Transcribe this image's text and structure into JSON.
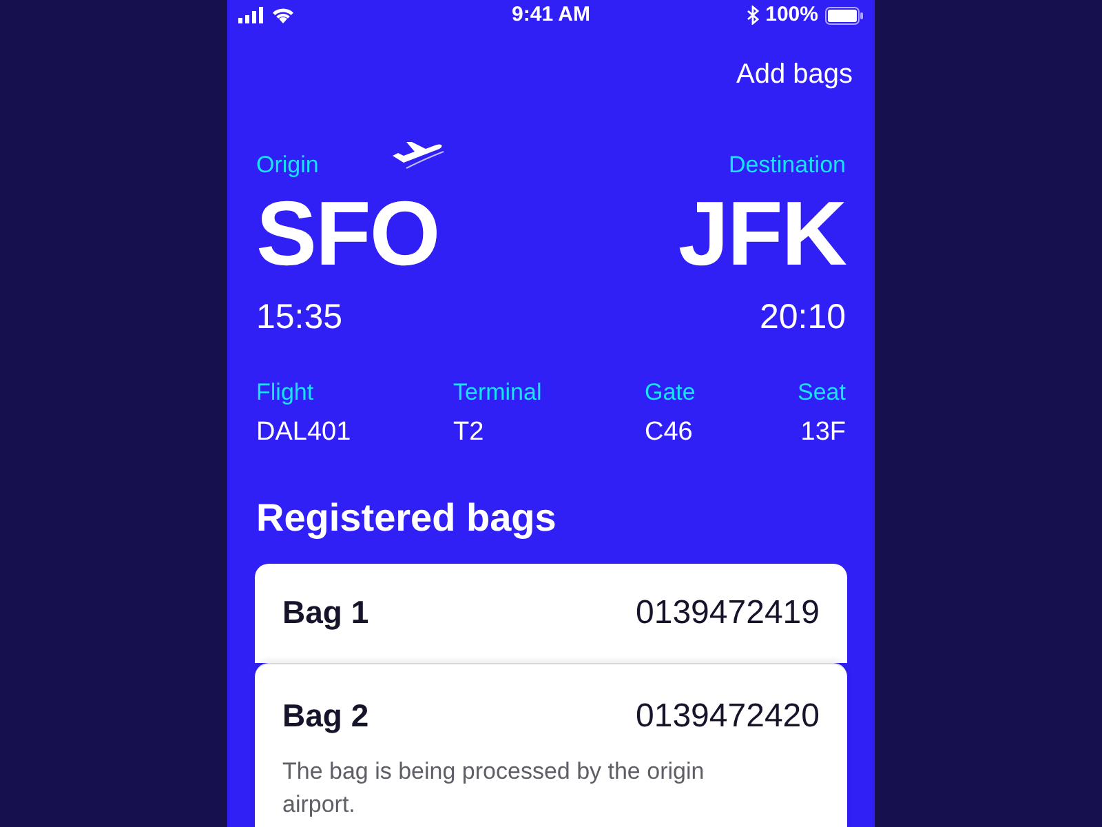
{
  "status_bar": {
    "time": "9:41 AM",
    "battery": "100%"
  },
  "header": {
    "action": "Add bags"
  },
  "route": {
    "origin": {
      "label": "Origin",
      "code": "SFO",
      "time": "15:35"
    },
    "destination": {
      "label": "Destination",
      "code": "JFK",
      "time": "20:10"
    }
  },
  "details": [
    {
      "label": "Flight",
      "value": "DAL401"
    },
    {
      "label": "Terminal",
      "value": "T2"
    },
    {
      "label": "Gate",
      "value": "C46"
    },
    {
      "label": "Seat",
      "value": "13F"
    }
  ],
  "bags_section": {
    "title": "Registered bags",
    "bags": [
      {
        "name": "Bag 1",
        "number": "0139472419"
      },
      {
        "name": "Bag 2",
        "number": "0139472420",
        "status": "The bag is being processed by the origin airport."
      }
    ]
  }
}
